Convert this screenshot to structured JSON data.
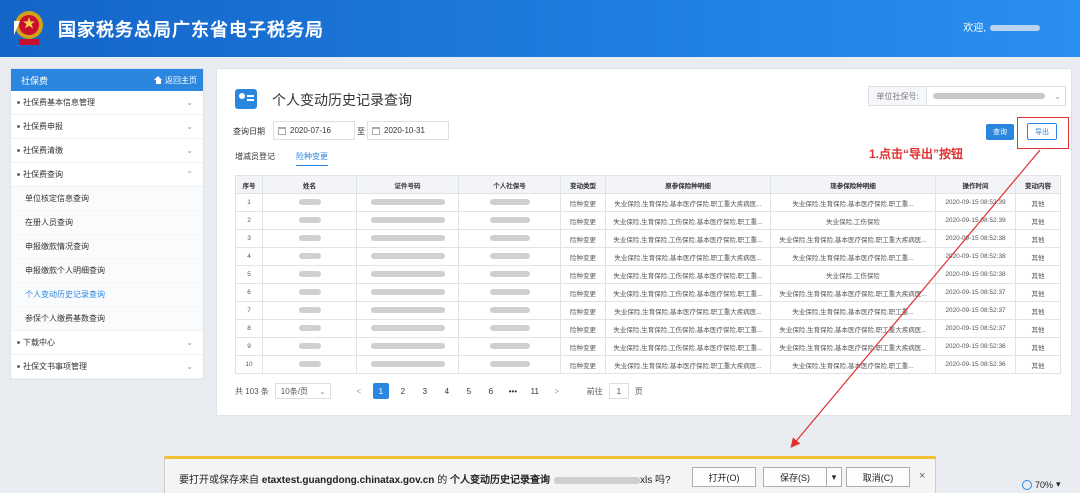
{
  "header": {
    "title": "国家税务总局广东省电子税务局",
    "welcome": "欢迎,"
  },
  "sidebar": {
    "title": "社保费",
    "home_link": "返回主页",
    "menu": [
      {
        "label": "社保费基本信息管理",
        "expanded": false
      },
      {
        "label": "社保费申报",
        "expanded": false
      },
      {
        "label": "社保费清缴",
        "expanded": false
      },
      {
        "label": "社保费查询",
        "expanded": true
      }
    ],
    "sub_items": [
      "单位核定信息查询",
      "在册人员查询",
      "申报缴款情况查询",
      "申报缴款个人明细查询",
      "个人变动历史记录查询",
      "参保个人缴费基数查询"
    ],
    "active_sub": "个人变动历史记录查询",
    "menu_after": [
      {
        "label": "下载中心"
      },
      {
        "label": "社保文书事项管理"
      }
    ]
  },
  "main": {
    "page_title": "个人变动历史记录查询",
    "unit_label": "单位社保号:",
    "date_label": "查询日期",
    "date_from": "2020-07-16",
    "date_to": "2020-10-31",
    "to_label": "至",
    "query_button": "查询",
    "export_button": "导出",
    "annotation": "1.点击“导出”按钮",
    "tabs": [
      "增减员登记",
      "险种变更"
    ],
    "active_tab": "险种变更"
  },
  "table": {
    "headers": [
      "序号",
      "姓名",
      "证件号码",
      "个人社保号",
      "变动类型",
      "原参保险种明细",
      "现参保险种明细",
      "操作时间",
      "变动内容"
    ],
    "rows": [
      [
        "1",
        "险种变更",
        "失业保险,生育保险,基本医疗保险,职工重大疾病医...",
        "失业保险,生育保险,基本医疗保险,职工重...",
        "2020-09-15 08:52:39",
        "其他"
      ],
      [
        "2",
        "险种变更",
        "失业保险,生育保险,工伤保险,基本医疗保险,职工重...",
        "失业保险,工伤保险",
        "2020-09-15 08:52:39",
        "其他"
      ],
      [
        "3",
        "险种变更",
        "失业保险,生育保险,工伤保险,基本医疗保险,职工重...",
        "失业保险,生育保险,基本医疗保险,职工重大疾病医...",
        "2020-09-15 08:52:38",
        "其他"
      ],
      [
        "4",
        "险种变更",
        "失业保险,生育保险,基本医疗保险,职工重大疾病医...",
        "失业保险,生育保险,基本医疗保险,职工重...",
        "2020-09-15 08:52:38",
        "其他"
      ],
      [
        "5",
        "险种变更",
        "失业保险,生育保险,工伤保险,基本医疗保险,职工重...",
        "失业保险,工伤保险",
        "2020-09-15 08:52:38",
        "其他"
      ],
      [
        "6",
        "险种变更",
        "失业保险,生育保险,工伤保险,基本医疗保险,职工重...",
        "失业保险,生育保险,基本医疗保险,职工重大疾病医...",
        "2020-09-15 08:52:37",
        "其他"
      ],
      [
        "7",
        "险种变更",
        "失业保险,生育保险,基本医疗保险,职工重大疾病医...",
        "失业保险,生育保险,基本医疗保险,职工重...",
        "2020-09-15 08:52:37",
        "其他"
      ],
      [
        "8",
        "险种变更",
        "失业保险,生育保险,工伤保险,基本医疗保险,职工重...",
        "失业保险,生育保险,基本医疗保险,职工重大疾病医...",
        "2020-09-15 08:52:37",
        "其他"
      ],
      [
        "9",
        "险种变更",
        "失业保险,生育保险,工伤保险,基本医疗保险,职工重...",
        "失业保险,生育保险,基本医疗保险,职工重大疾病医...",
        "2020-09-15 08:52:36",
        "其他"
      ],
      [
        "10",
        "险种变更",
        "失业保险,生育保险,基本医疗保险,职工重大疾病医...",
        "失业保险,生育保险,基本医疗保险,职工重...",
        "2020-09-15 08:52:36",
        "其他"
      ]
    ]
  },
  "pager": {
    "total": "共 103 条",
    "page_size": "10条/页",
    "pages": [
      "1",
      "2",
      "3",
      "4",
      "5",
      "6",
      "•••",
      "11"
    ],
    "prev": "<",
    "next": ">",
    "goto_label": "前往",
    "goto_value": "1",
    "goto_suffix": "页"
  },
  "download_bar": {
    "prefix": "要打开或保存来自",
    "domain": "etaxtest.guangdong.chinatax.gov.cn",
    "middle": "的",
    "filename": "个人变动历史记录查询",
    "suffix": "xls 吗?",
    "open": "打开(O)",
    "save": "保存(S)",
    "save_dropdown": "▾",
    "cancel": "取消(C)",
    "close": "×"
  },
  "status": {
    "zoom": "70%",
    "zoom_arrow": "▾"
  },
  "colors": {
    "header": "#1e7fe0",
    "accent": "#2b86e0",
    "annotation": "#e03030",
    "dlbar_border": "#f1c232"
  }
}
